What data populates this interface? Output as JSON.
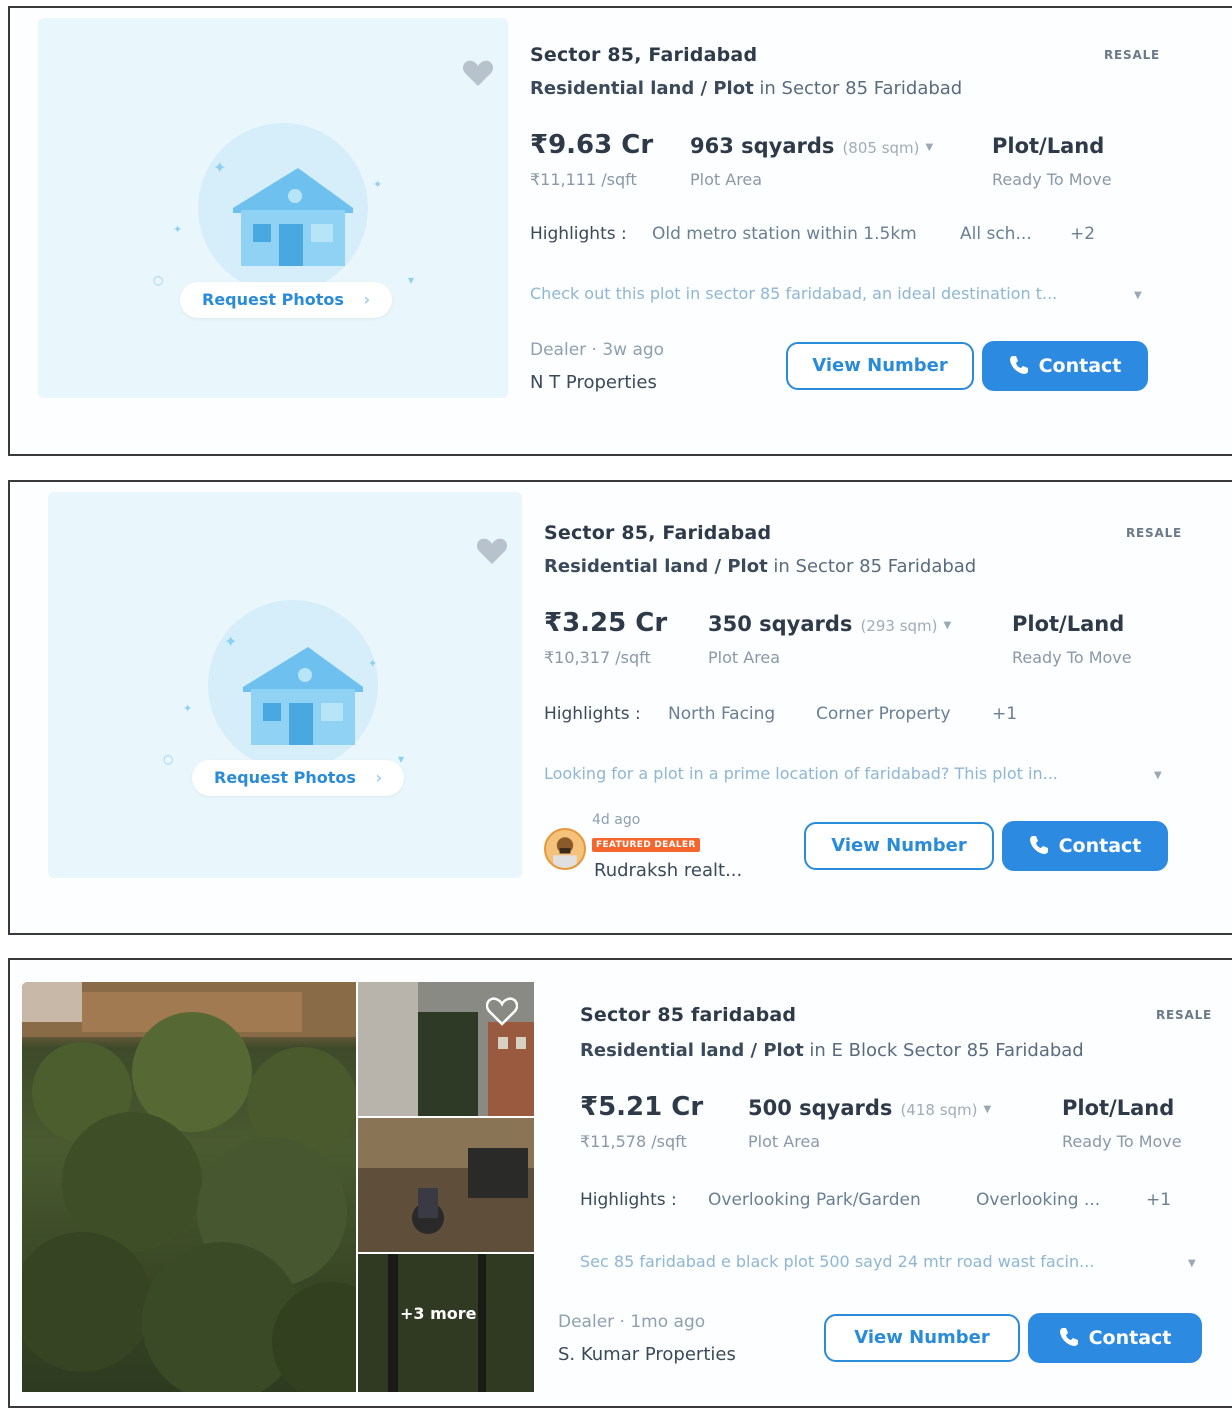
{
  "listings": [
    {
      "title": "Sector 85, Faridabad",
      "tag": "RESALE",
      "type_bold": "Residential land / Plot",
      "type_rest": " in Sector 85 Faridabad",
      "price": "₹9.63 Cr",
      "price_sqft": "₹11,111 /sqft",
      "area": "963 sqyards",
      "area_sqm": "(805 sqm)",
      "area_label": "Plot Area",
      "prop_type": "Plot/Land",
      "status": "Ready To Move",
      "highlights_label": "Highlights :",
      "highlights": [
        "Old metro station within 1.5km",
        "All sch...",
        "+2"
      ],
      "description": "Check out this plot in sector 85 faridabad, an ideal destination t...",
      "dealer_line": "Dealer · 3w ago",
      "dealer_name": "N T Properties",
      "request_photos": "Request Photos",
      "view_number": "View Number",
      "contact": "Contact"
    },
    {
      "title": "Sector 85, Faridabad",
      "tag": "RESALE",
      "type_bold": "Residential land / Plot",
      "type_rest": " in Sector 85 Faridabad",
      "price": "₹3.25 Cr",
      "price_sqft": "₹10,317 /sqft",
      "area": "350 sqyards",
      "area_sqm": "(293 sqm)",
      "area_label": "Plot Area",
      "prop_type": "Plot/Land",
      "status": "Ready To Move",
      "highlights_label": "Highlights :",
      "highlights": [
        "North Facing",
        "Corner Property",
        "+1"
      ],
      "description": "Looking for a plot in a prime location of faridabad? This plot in...",
      "dealer_ago": "4d ago",
      "featured": "FEATURED DEALER",
      "dealer_name": "Rudraksh realt...",
      "request_photos": "Request Photos",
      "view_number": "View Number",
      "contact": "Contact"
    },
    {
      "title": "Sector 85 faridabad",
      "tag": "RESALE",
      "type_bold": "Residential land / Plot",
      "type_rest": " in E Block Sector 85 Faridabad",
      "price": "₹5.21 Cr",
      "price_sqft": "₹11,578 /sqft",
      "area": "500 sqyards",
      "area_sqm": "(418 sqm)",
      "area_label": "Plot Area",
      "prop_type": "Plot/Land",
      "status": "Ready To Move",
      "highlights_label": "Highlights :",
      "highlights": [
        "Overlooking Park/Garden",
        "Overlooking ...",
        "+1"
      ],
      "description": "Sec 85 faridabad e black plot 500 sayd 24 mtr road wast facin...",
      "dealer_line": "Dealer · 1mo ago",
      "dealer_name": "S. Kumar Properties",
      "more_photos": "+3 more",
      "view_number": "View Number",
      "contact": "Contact"
    }
  ],
  "colors": {
    "accent": "#2c8ae0",
    "featured_badge": "#f5662f",
    "placeholder_bg": "#e9f6fc"
  }
}
